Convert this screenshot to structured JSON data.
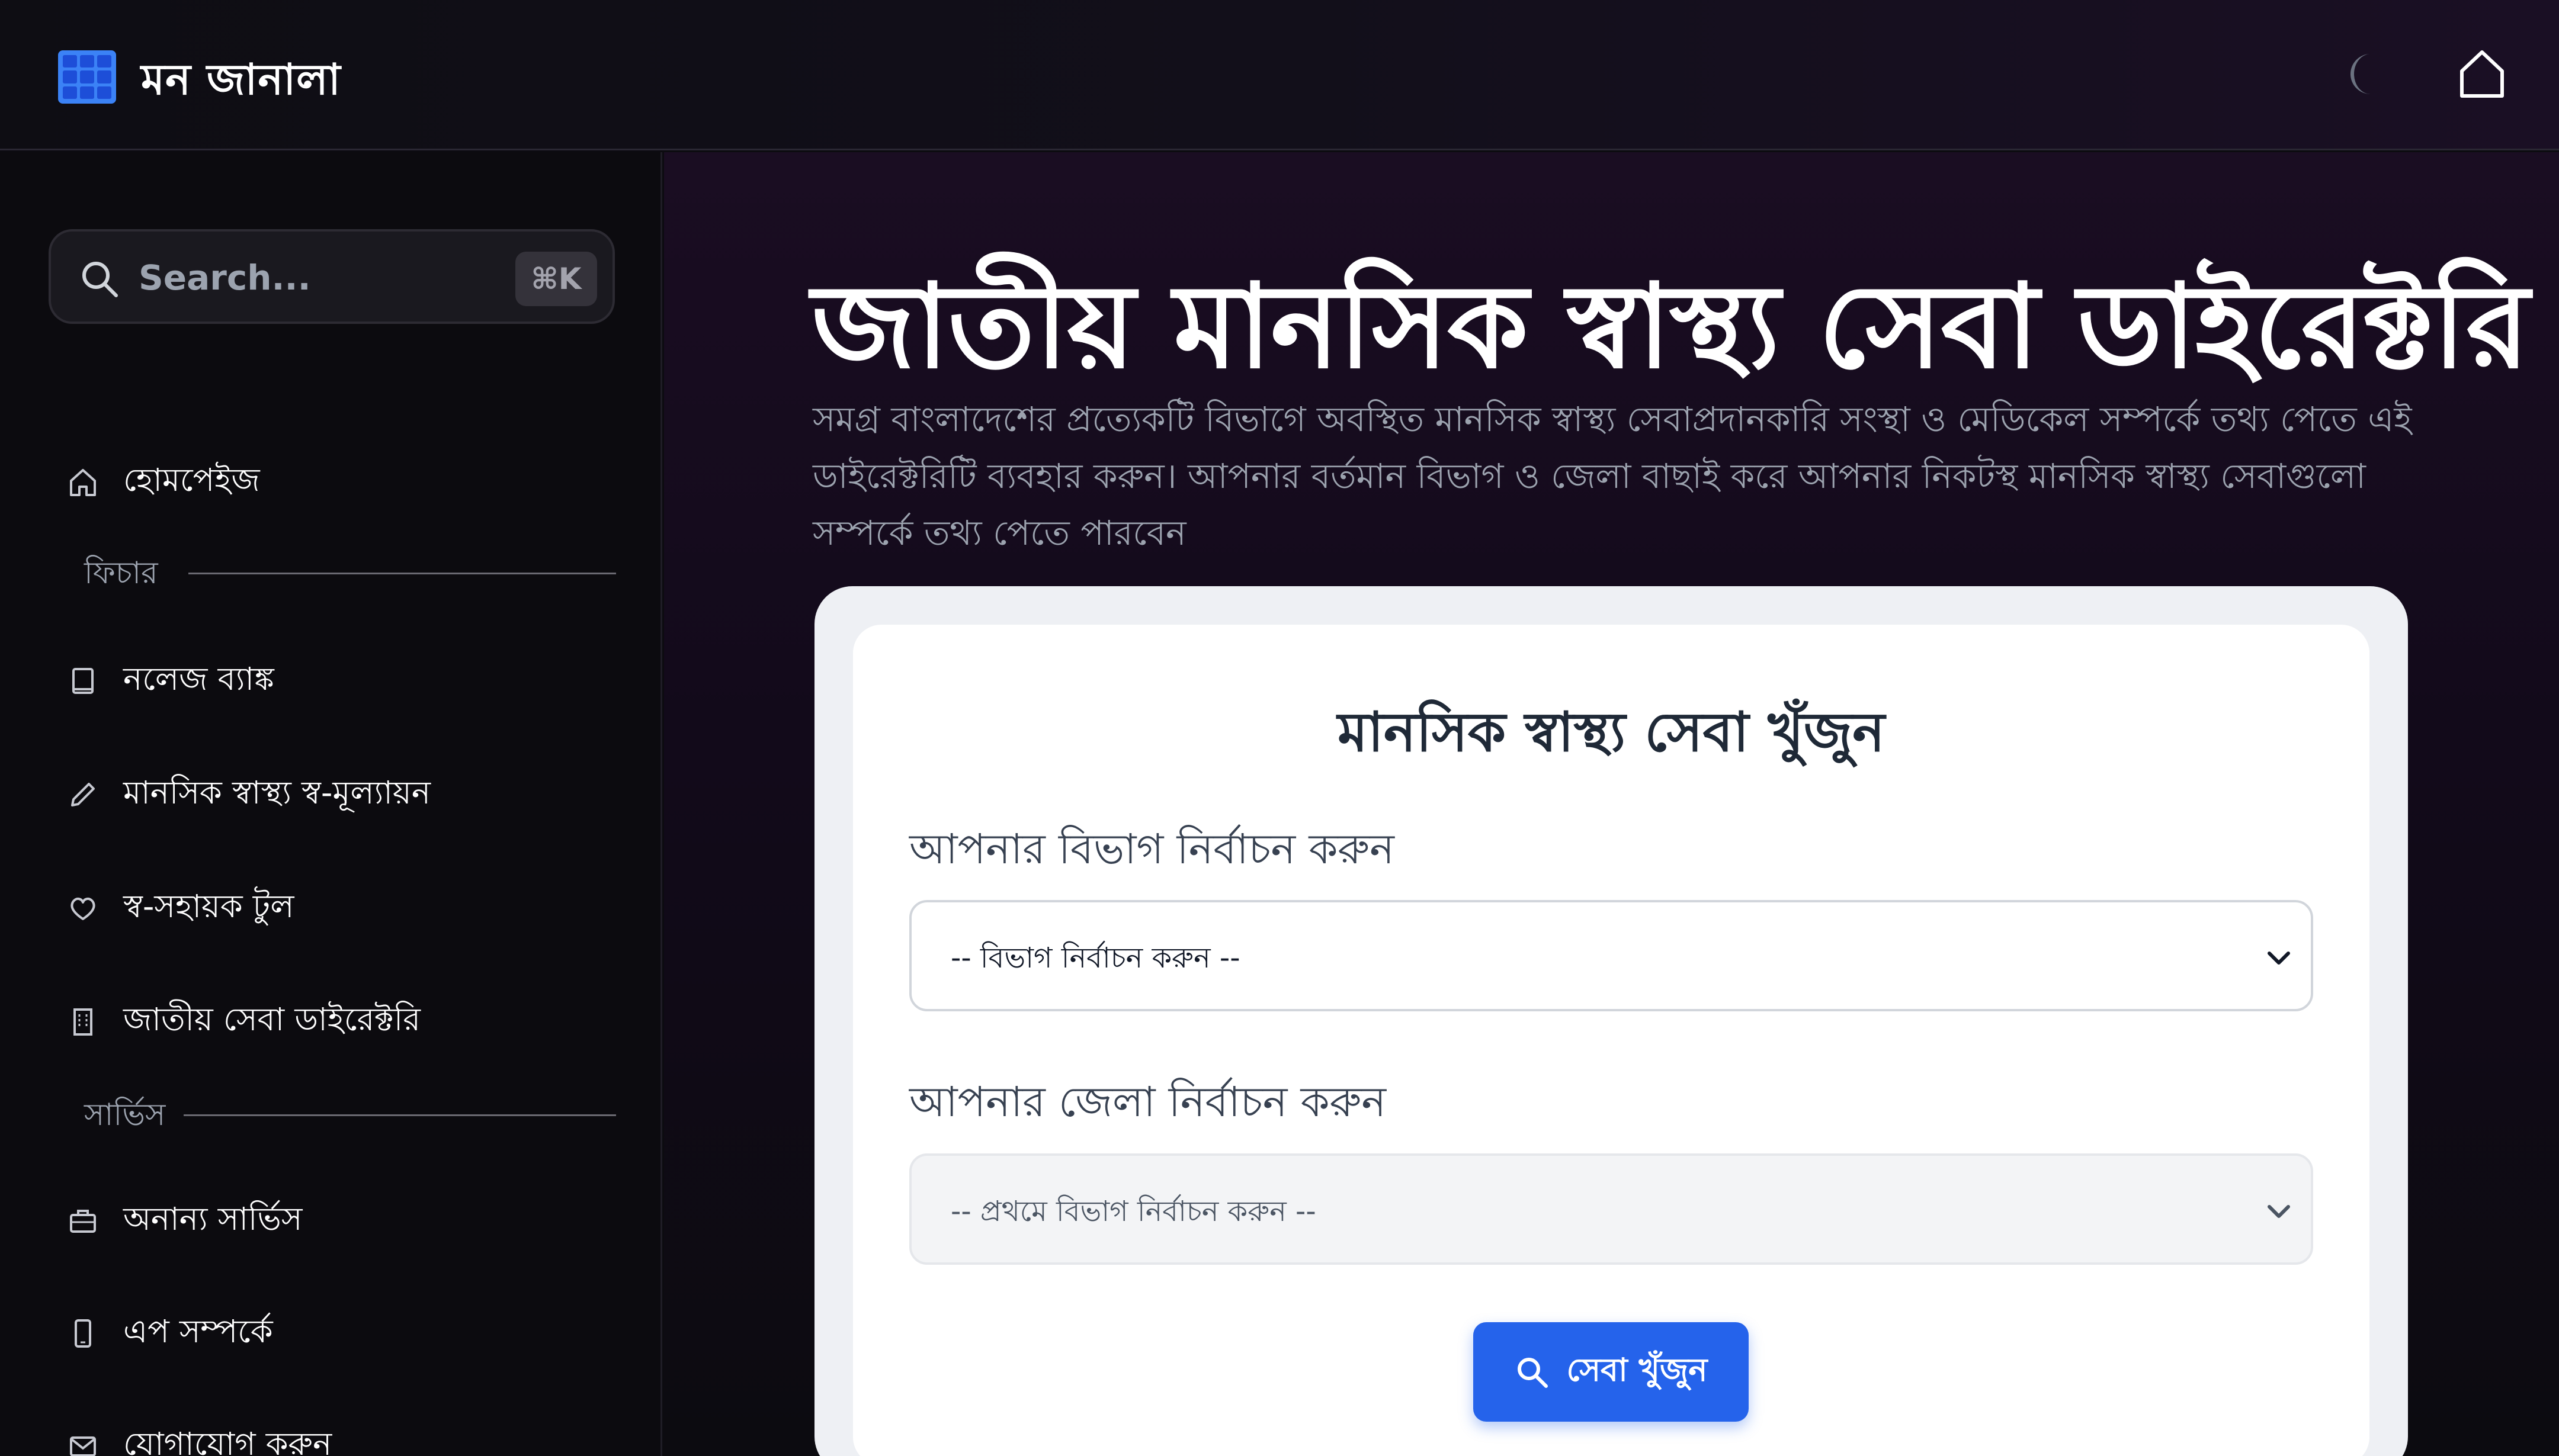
{
  "header": {
    "app_title": "মন জানালা",
    "logo_icon": "grid-logo-icon",
    "theme_toggle_icon": "moon-icon",
    "home_icon": "home-icon"
  },
  "sidebar": {
    "search": {
      "placeholder": "Search...",
      "shortcut": "⌘K"
    },
    "items": [
      {
        "label": "হোমপেইজ",
        "icon": "home-icon"
      },
      {
        "label": "নলেজ ব্যাঙ্ক",
        "icon": "book-icon"
      },
      {
        "label": "মানসিক স্বাস্থ্য স্ব-মূল্যায়ন",
        "icon": "pencil-icon"
      },
      {
        "label": "স্ব-সহায়ক টুল",
        "icon": "heart-icon"
      },
      {
        "label": "জাতীয় সেবা ডাইরেক্টরি",
        "icon": "building-icon"
      },
      {
        "label": "অনান্য সার্ভিস",
        "icon": "briefcase-icon"
      },
      {
        "label": "এপ সম্পর্কে",
        "icon": "phone-icon"
      },
      {
        "label": "যোগাযোগ করুন",
        "icon": "mail-icon"
      }
    ],
    "sections": {
      "features": "ফিচার",
      "services": "সার্ভিস"
    }
  },
  "main": {
    "title": "জাতীয় মানসিক স্বাস্থ্য সেবা ডাইরেক্টরি",
    "description": "সমগ্র বাংলাদেশের প্রত্যেকটি বিভাগে অবস্থিত মানসিক স্বাস্থ্য সেবাপ্রদানকারি সংস্থা ও মেডিকেল সম্পর্কে তথ্য পেতে এই ডাইরেক্টরিটি ব্যবহার করুন। আপনার বর্তমান বিভাগ ও জেলা বাছাই করে আপনার নিকটস্থ মানসিক স্বাস্থ্য সেবাগুলো সম্পর্কে তথ্য পেতে পারবেন",
    "card": {
      "title": "মানসিক স্বাস্থ্য সেবা খুঁজুন",
      "division_label": "আপনার বিভাগ নির্বাচন করুন",
      "division_selected": "-- বিভাগ নির্বাচন করুন --",
      "district_label": "আপনার জেলা নির্বাচন করুন",
      "district_selected": "-- প্রথমে বিভাগ নির্বাচন করুন --",
      "button_label": "সেবা খুঁজুন"
    }
  },
  "colors": {
    "accent": "#2563eb",
    "logo": "#3b82f6",
    "background": "#0c0b10"
  }
}
